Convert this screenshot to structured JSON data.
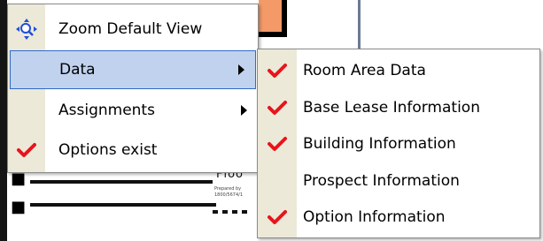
{
  "menu": {
    "items": [
      {
        "label": "Zoom Default View",
        "icon": "zoom-view-icon"
      },
      {
        "label": "Data",
        "has_submenu": true,
        "highlighted": true
      },
      {
        "label": "Assignments",
        "has_submenu": true
      },
      {
        "label": "Options exist",
        "checked": true
      }
    ]
  },
  "submenu": {
    "items": [
      {
        "label": "Room Area Data",
        "checked": true
      },
      {
        "label": "Base Lease Information",
        "checked": true
      },
      {
        "label": "Building Information",
        "checked": true
      },
      {
        "label": "Prospect Information",
        "checked": false
      },
      {
        "label": "Option Information",
        "checked": true
      }
    ]
  },
  "background": {
    "doc_heading_fragment": "Floo",
    "doc_small_text": "Prepared by\n1800/5674/1"
  },
  "colors": {
    "menu_gutter": "#ece9d8",
    "highlight_fill": "#c1d2ee",
    "highlight_border": "#316ac5",
    "check_red": "#e8141c",
    "zoom_icon_blue": "#1f4fd8"
  }
}
